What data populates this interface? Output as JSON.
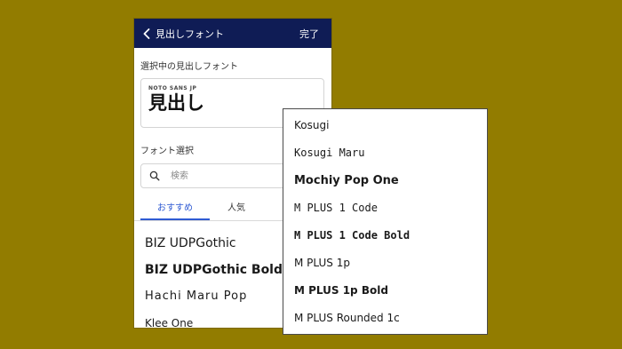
{
  "header": {
    "back_label": "見出しフォント",
    "done_label": "完了"
  },
  "selected": {
    "section_label": "選択中の見出しフォント",
    "font_name": "NOTO SANS JP",
    "sample_text": "見出し"
  },
  "font_select": {
    "section_label": "フォント選択",
    "search_placeholder": "検索"
  },
  "tabs": [
    {
      "label": "おすすめ",
      "active": true
    },
    {
      "label": "人気",
      "active": false
    }
  ],
  "font_list": [
    "BIZ UDPGothic",
    "BIZ UDPGothic Bold",
    "Hachi Maru Pop",
    "Klee One"
  ],
  "dropdown_items": [
    "Kosugi",
    "Kosugi Maru",
    "Mochiy Pop One",
    "M PLUS 1 Code",
    "M PLUS 1 Code Bold",
    "M PLUS 1p",
    "M PLUS 1p Bold",
    "M PLUS Rounded 1c"
  ],
  "colors": {
    "background": "#927c00",
    "header_bg": "#0f1c55",
    "accent": "#2f5bd3"
  },
  "icons": {
    "back": "chevron-left-icon",
    "search": "search-icon"
  }
}
